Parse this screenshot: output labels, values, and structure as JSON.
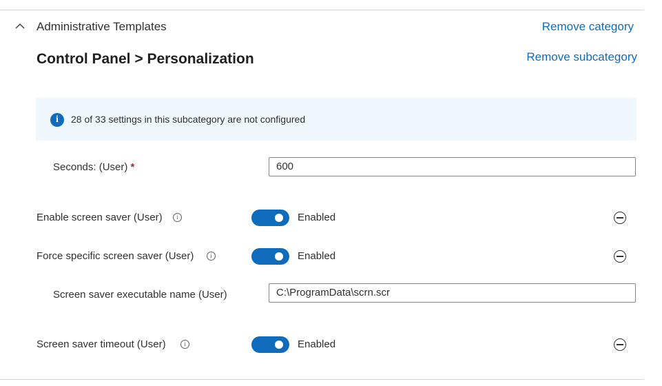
{
  "category": {
    "title": "Administrative Templates",
    "remove_label": "Remove category"
  },
  "subcategory": {
    "title": "Control Panel > Personalization",
    "remove_label": "Remove subcategory"
  },
  "banner": {
    "text": "28 of 33 settings in this subcategory are not configured"
  },
  "settings": [
    {
      "label": "Seconds: (User)",
      "required": "*",
      "value": "600"
    },
    {
      "label": "Enable screen saver (User)",
      "state": "Enabled"
    },
    {
      "label": "Force specific screen saver (User)",
      "state": "Enabled"
    },
    {
      "label": "Screen saver executable name (User)",
      "value": "C:\\ProgramData\\scrn.scr"
    },
    {
      "label": "Screen saver timeout (User)",
      "state": "Enabled"
    }
  ],
  "colors": {
    "accent": "#0f6cbd",
    "banner_bg": "#eff6fc",
    "required": "#a4262c"
  }
}
